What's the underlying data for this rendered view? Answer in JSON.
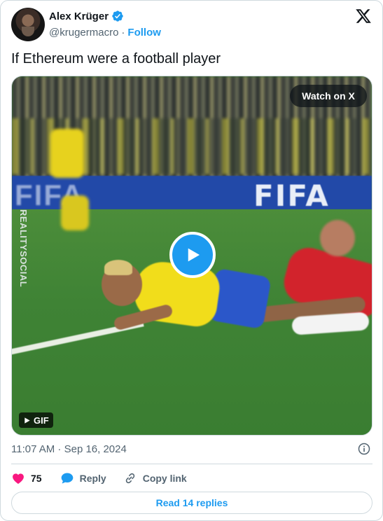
{
  "author": {
    "name": "Alex Krüger",
    "handle": "@krugermacro",
    "separator": "·",
    "follow_label": "Follow"
  },
  "tweet": {
    "text": "If Ethereum were a football player",
    "timestamp": "11:07 AM · Sep 16, 2024"
  },
  "media": {
    "watch_label": "Watch on X",
    "gif_label": "GIF",
    "watermark_text": "REALITYSOCIAL",
    "board_text_left": "FIFA",
    "board_text_right": "FIFA"
  },
  "actions": {
    "likes_count": "75",
    "reply_label": "Reply",
    "copy_link_label": "Copy link"
  },
  "footer": {
    "read_replies_label": "Read 14 replies"
  },
  "colors": {
    "accent": "#1d9bf0",
    "like": "#f91880",
    "text_primary": "#0f1419",
    "text_secondary": "#536471",
    "border": "#cfd9de"
  },
  "icons": [
    "verified-badge-icon",
    "x-logo-icon",
    "play-icon",
    "gif-play-icon",
    "info-icon",
    "heart-icon",
    "reply-bubble-icon",
    "link-icon",
    "twitter-bird-icon"
  ]
}
